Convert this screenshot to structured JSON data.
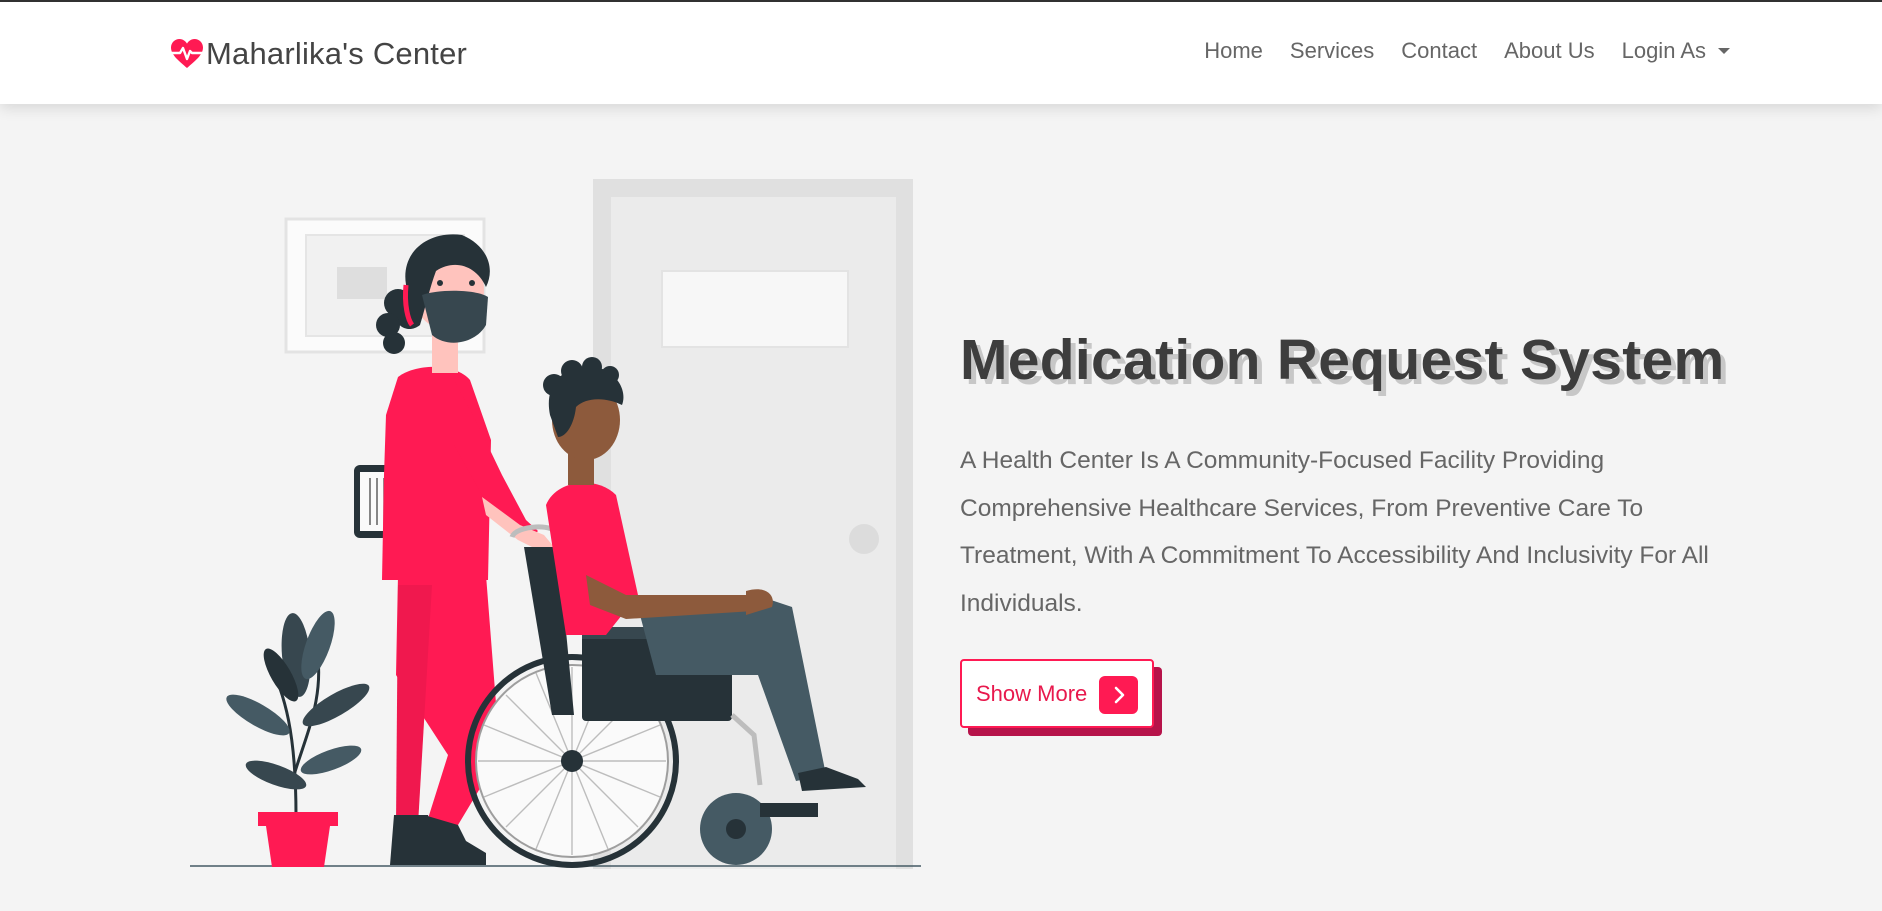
{
  "colors": {
    "accent": "#ff1a53",
    "accent_dark": "#b6134a",
    "heading": "#3d3d3d",
    "body_text": "#666666",
    "page_background": "#f4f4f4",
    "navbar_background": "#ffffff"
  },
  "navbar": {
    "brand": {
      "icon": "heart-pulse-icon",
      "name": "Maharlika's Center"
    },
    "links": [
      {
        "label": "Home"
      },
      {
        "label": "Services"
      },
      {
        "label": "Contact"
      },
      {
        "label": "About Us"
      },
      {
        "label": "Login As",
        "icon": "caret-down-icon"
      }
    ]
  },
  "hero": {
    "title": "Medication Request System",
    "description": "A Health Center Is A Community-Focused Facility Providing Comprehensive Healthcare Services, From Preventive Care To Treatment, With A Commitment To Accessibility And Inclusivity For All Individuals.",
    "button": {
      "label": "Show More",
      "icon": "chevron-right-icon"
    }
  }
}
